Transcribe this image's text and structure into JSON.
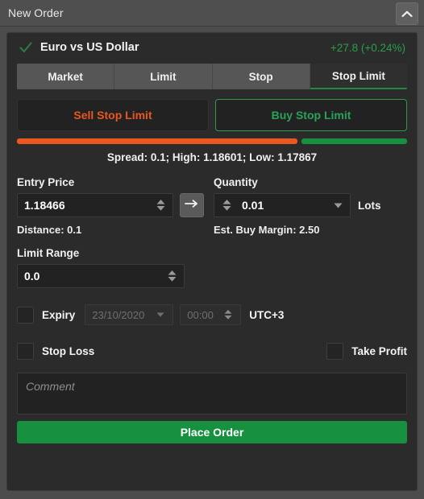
{
  "window": {
    "title": "New Order",
    "collapse_icon": "chevron-up-icon"
  },
  "symbol": {
    "status_icon": "checkmark-icon",
    "name": "Euro vs US Dollar",
    "change": "+27.8 (+0.24%)",
    "change_color": "#2a9d4a"
  },
  "tabs": [
    {
      "label": "Market",
      "active": false
    },
    {
      "label": "Limit",
      "active": false
    },
    {
      "label": "Stop",
      "active": false
    },
    {
      "label": "Stop Limit",
      "active": true
    }
  ],
  "side_buttons": {
    "sell_label": "Sell Stop Limit",
    "buy_label": "Buy Stop Limit",
    "sell_color": "#e8581f",
    "buy_color": "#29a357",
    "selected": "buy"
  },
  "spread": {
    "sell_percent": 72,
    "buy_percent": 28,
    "text": "Spread: 0.1; High: 1.18601; Low: 1.17867"
  },
  "entry": {
    "label": "Entry Price",
    "value": "1.18466",
    "spinner_icon": "up-down-spinner-icon",
    "arrow_icon": "arrow-right-icon",
    "distance": "Distance: 0.1"
  },
  "quantity": {
    "label": "Quantity",
    "value": "0.01",
    "spinner_icon": "up-down-spinner-icon",
    "dropdown_icon": "caret-down-icon",
    "unit": "Lots",
    "margin": "Est. Buy Margin: 2.50"
  },
  "limit_range": {
    "label": "Limit Range",
    "value": "0.0",
    "spinner_icon": "up-down-spinner-icon"
  },
  "expiry": {
    "label": "Expiry",
    "checked": false,
    "date": "23/10/2020",
    "date_dropdown_icon": "caret-down-icon",
    "time": "00:00",
    "time_spinner_icon": "up-down-spinner-icon",
    "timezone": "UTC+3"
  },
  "stop_loss": {
    "label": "Stop Loss",
    "checked": false
  },
  "take_profit": {
    "label": "Take Profit",
    "checked": false
  },
  "comment": {
    "placeholder": "Comment",
    "value": ""
  },
  "place_order": {
    "label": "Place Order",
    "color": "#17913f"
  }
}
